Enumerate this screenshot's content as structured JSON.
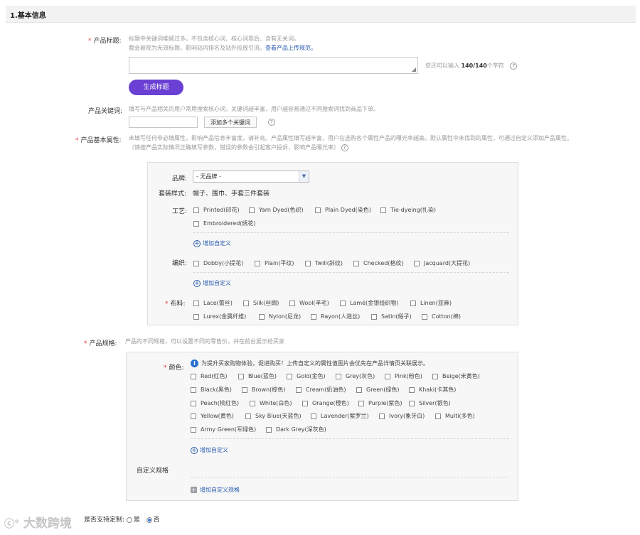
{
  "section_title": "1.基本信息",
  "title_field": {
    "label": "产品标题:",
    "hint_line1": "标题中关键词堆砌过多，不包含核心词、核心词靠后、含有无关词。",
    "hint_line2": "都会被视为无效标题，影响站内排名及站外投放引流。",
    "hint_link": "查看产品上传规范。",
    "counter_prefix": "您还可以输入",
    "counter_value": "140/140",
    "counter_suffix": "个字符",
    "generate_button": "生成标题"
  },
  "keyword_field": {
    "label": "产品关键词:",
    "hint": "填写与产品相关的用户常用搜索核心词，关键词越丰富，用户越容易通过不同搜索词找到商品下单。",
    "add_button": "添加多个关键词"
  },
  "attributes": {
    "label": "产品基本属性:",
    "hint_line1": "未填写任何非必填属性，影响产品信息丰富度，请补充。产品属性填写越丰富，用户在选购各个属性产品的曝光率越高。默认属性中未找到的属性，可通过自定义添加产品属性。",
    "hint_line2": "（请按产品实际情况正确填写参数，错误的参数会引起客户投诉，影响产品曝光率）",
    "brand_label": "品牌:",
    "brand_value": "- 无品牌 -",
    "set_style_label": "套装样式:",
    "set_style_value": "帽子、围巾、手套三件套装",
    "craft_label": "工艺:",
    "craft_options": [
      "Printed(印花)",
      "Yarn Dyed(色织)",
      "Plain Dyed(染色)",
      "Tie-dyeing(扎染)",
      "Embroidered(绣花)"
    ],
    "add_custom": "增加自定义",
    "weave_label": "编织:",
    "weave_options": [
      "Dobby(小提花)",
      "Plain(平纹)",
      "Twill(斜纹)",
      "Checked(格纹)",
      "Jacquard(大提花)"
    ],
    "fabric_label": "布料:",
    "fabric_row1": [
      "Lace(蕾丝)",
      "Silk(丝绸)",
      "Wool(羊毛)",
      "Lamé(金银线织物)",
      "Linen(亚麻)"
    ],
    "fabric_row2": [
      "Lurex(金属纤维)",
      "Nylon(尼龙)",
      "Rayon(人造丝)",
      "Satin(缎子)",
      "Cotton(棉)"
    ]
  },
  "spec": {
    "label": "产品规格:",
    "hint": "产品的不同规格，可以设置不同的零售价，并在前台展示给买家",
    "color_label": "颜色:",
    "color_tip": "为提升买家购物体验，促进购买！上传自定义的属性值图片会优先在产品详情页关联展示。",
    "colors_row1": [
      "Red(红色)",
      "Blue(蓝色)",
      "Gold(金色)",
      "Grey(灰色)",
      "Pink(粉色)",
      "Beige(米黄色)"
    ],
    "colors_row2": [
      "Black(黑色)",
      "Brown(棕色)",
      "Cream(奶油色)",
      "Green(绿色)",
      "Khaki(卡其色)"
    ],
    "colors_row3": [
      "Peach(桃红色)",
      "White(白色)",
      "Orange(橙色)",
      "Purple(紫色)",
      "Silver(银色)"
    ],
    "colors_row4": [
      "Yellow(黄色)",
      "Sky Blue(天蓝色)",
      "Lavender(紫罗兰)",
      "Ivory(象牙白)",
      "Multi(多色)"
    ],
    "colors_row5": [
      "Army Green(军绿色)",
      "Dark Grey(深灰色)"
    ],
    "add_custom": "增加自定义",
    "custom_spec_label": "自定义规格",
    "add_custom_spec": "增加自定义规格"
  },
  "customization": {
    "label": "是否支持定制:",
    "yes": "是",
    "no": "否",
    "selected": "否"
  },
  "watermark": "大数跨境"
}
